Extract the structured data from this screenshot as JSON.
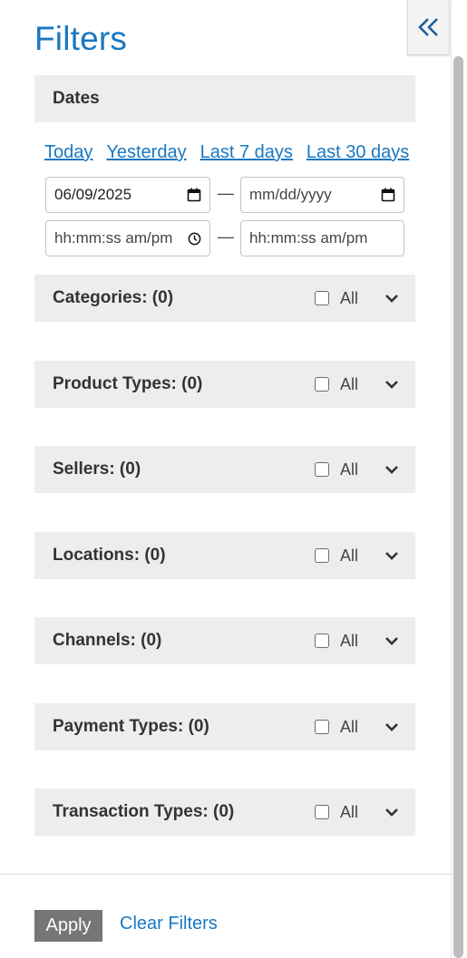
{
  "title": "Filters",
  "dates": {
    "header": "Dates",
    "quick_links": [
      "Today",
      "Yesterday",
      "Last 7 days",
      "Last 30 days"
    ],
    "start_date": "06/09/2025",
    "end_date_placeholder": "mm/dd/yyyy",
    "start_time_placeholder": "hh:mm:ss am/pm",
    "end_time_placeholder": "hh:mm:ss am/pm",
    "separator": "—"
  },
  "sections": [
    {
      "title": "Categories: (0)",
      "all_label": "All"
    },
    {
      "title": "Product Types: (0)",
      "all_label": "All"
    },
    {
      "title": "Sellers: (0)",
      "all_label": "All"
    },
    {
      "title": "Locations: (0)",
      "all_label": "All"
    },
    {
      "title": "Channels: (0)",
      "all_label": "All"
    },
    {
      "title": "Payment Types: (0)",
      "all_label": "All"
    },
    {
      "title": "Transaction Types: (0)",
      "all_label": "All"
    }
  ],
  "footer": {
    "apply_label": "Apply",
    "clear_label": "Clear Filters"
  },
  "colors": {
    "accent": "#1a78c2",
    "header_bg": "#ededed",
    "apply_bg": "#767676"
  },
  "icons": {
    "collapse": "double-chevron-left-icon",
    "expand": "chevron-down-icon",
    "calendar": "calendar-icon",
    "clock": "clock-icon"
  }
}
